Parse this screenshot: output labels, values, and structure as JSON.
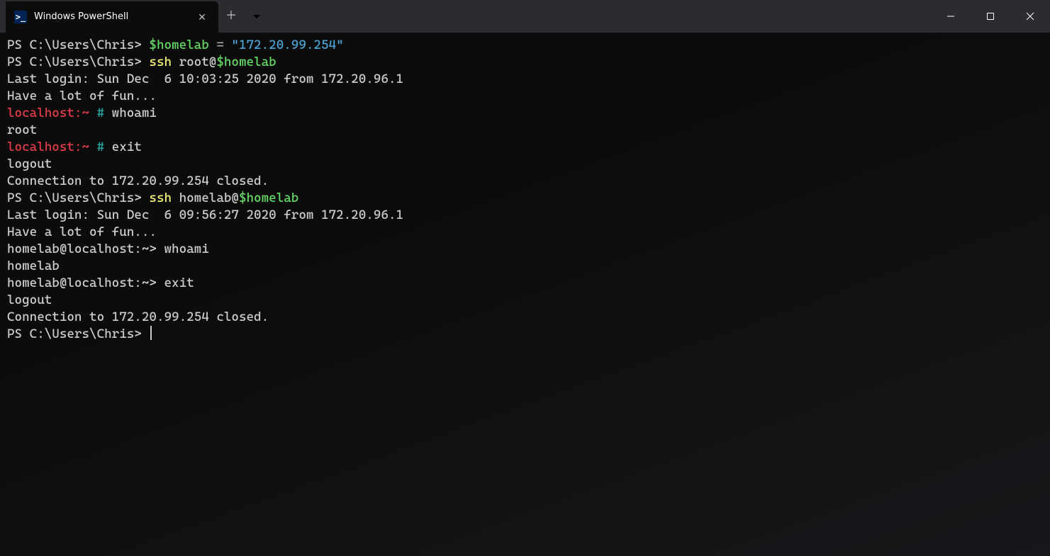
{
  "window": {
    "tab_title": "Windows PowerShell"
  },
  "prompts": {
    "ps": "PS C:\\Users\\Chris> ",
    "root_host": "localhost:~ ",
    "root_hash": "# ",
    "user": "homelab@localhost:~> "
  },
  "lines": [
    {
      "type": "ps_assign",
      "var": "$homelab",
      "op": " = ",
      "val": "\"172.20.99.254\""
    },
    {
      "type": "ps_cmd_ssh",
      "cmd": "ssh",
      "arg_plain": " root@",
      "arg_var": "$homelab"
    },
    {
      "type": "plain",
      "text": "Last login: Sun Dec  6 10:03:25 2020 from 172.20.96.1"
    },
    {
      "type": "plain",
      "text": "Have a lot of fun..."
    },
    {
      "type": "root_prompt",
      "cmd": "whoami"
    },
    {
      "type": "plain",
      "text": "root"
    },
    {
      "type": "root_prompt",
      "cmd": "exit"
    },
    {
      "type": "plain",
      "text": "logout"
    },
    {
      "type": "plain",
      "text": "Connection to 172.20.99.254 closed."
    },
    {
      "type": "ps_cmd_ssh",
      "cmd": "ssh",
      "arg_plain": " homelab@",
      "arg_var": "$homelab"
    },
    {
      "type": "plain",
      "text": "Last login: Sun Dec  6 09:56:27 2020 from 172.20.96.1"
    },
    {
      "type": "plain",
      "text": "Have a lot of fun..."
    },
    {
      "type": "user_prompt",
      "cmd": "whoami"
    },
    {
      "type": "plain",
      "text": "homelab"
    },
    {
      "type": "user_prompt",
      "cmd": "exit"
    },
    {
      "type": "plain",
      "text": "logout"
    },
    {
      "type": "plain",
      "text": "Connection to 172.20.99.254 closed."
    },
    {
      "type": "ps_cursor"
    }
  ]
}
